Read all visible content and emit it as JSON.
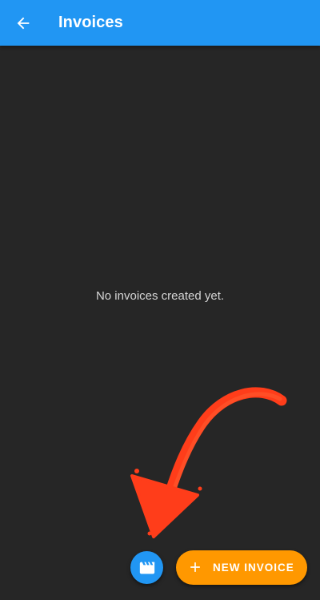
{
  "appbar": {
    "title": "Invoices",
    "back_icon": "arrow-back-icon",
    "color": "#2196f3"
  },
  "main": {
    "empty_message": "No invoices created yet.",
    "background": "#262626"
  },
  "actions": {
    "video_fab_icon": "movie-clapperboard-icon",
    "video_fab_color": "#2196f3",
    "new_invoice_label": "NEW INVOICE",
    "new_invoice_icon": "plus-icon",
    "new_invoice_color": "#ff9800"
  },
  "annotation": {
    "arrow_color": "#ff3d1a",
    "icon": "hand-drawn-arrow"
  }
}
